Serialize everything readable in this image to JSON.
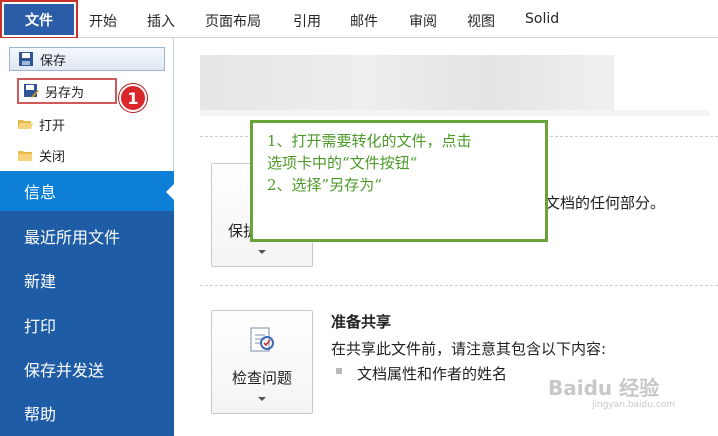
{
  "ribbon": {
    "file_tab": "文件",
    "tabs": [
      "开始",
      "插入",
      "页面布局",
      "引用",
      "邮件",
      "审阅",
      "视图",
      "Solid"
    ]
  },
  "sidebar": {
    "quick_actions": [
      {
        "label": "保存",
        "icon": "save-icon"
      },
      {
        "label": "另存为",
        "icon": "save-as-icon"
      },
      {
        "label": "打开",
        "icon": "open-folder-icon"
      },
      {
        "label": "关闭",
        "icon": "close-folder-icon"
      }
    ],
    "badge": "1",
    "nav": [
      "信息",
      "最近所用文件",
      "新建",
      "打印",
      "保存并发送",
      "帮助"
    ],
    "active_nav": "信息"
  },
  "main": {
    "protect": {
      "button_label": "保护",
      "desc": "此文档的任何部分。"
    },
    "prepare": {
      "button_label": "检查问题",
      "title": "准备共享",
      "desc": "在共享此文件前，请注意其包含以下内容:",
      "bullets": [
        "文档属性和作者的姓名"
      ]
    }
  },
  "callout": {
    "lines": [
      "1、打开需要转化的文件，点击",
      "选项卡中的“文件按钮“",
      "2、选择”另存为“"
    ]
  },
  "watermark": {
    "text": "Baidu 经验",
    "sub": "jingyan.baidu.com"
  },
  "colors": {
    "nav_bg": "#1f5ca6",
    "nav_active": "#0e7fd7",
    "annotation_red": "#d9262a",
    "callout_green": "#6aa33a"
  }
}
